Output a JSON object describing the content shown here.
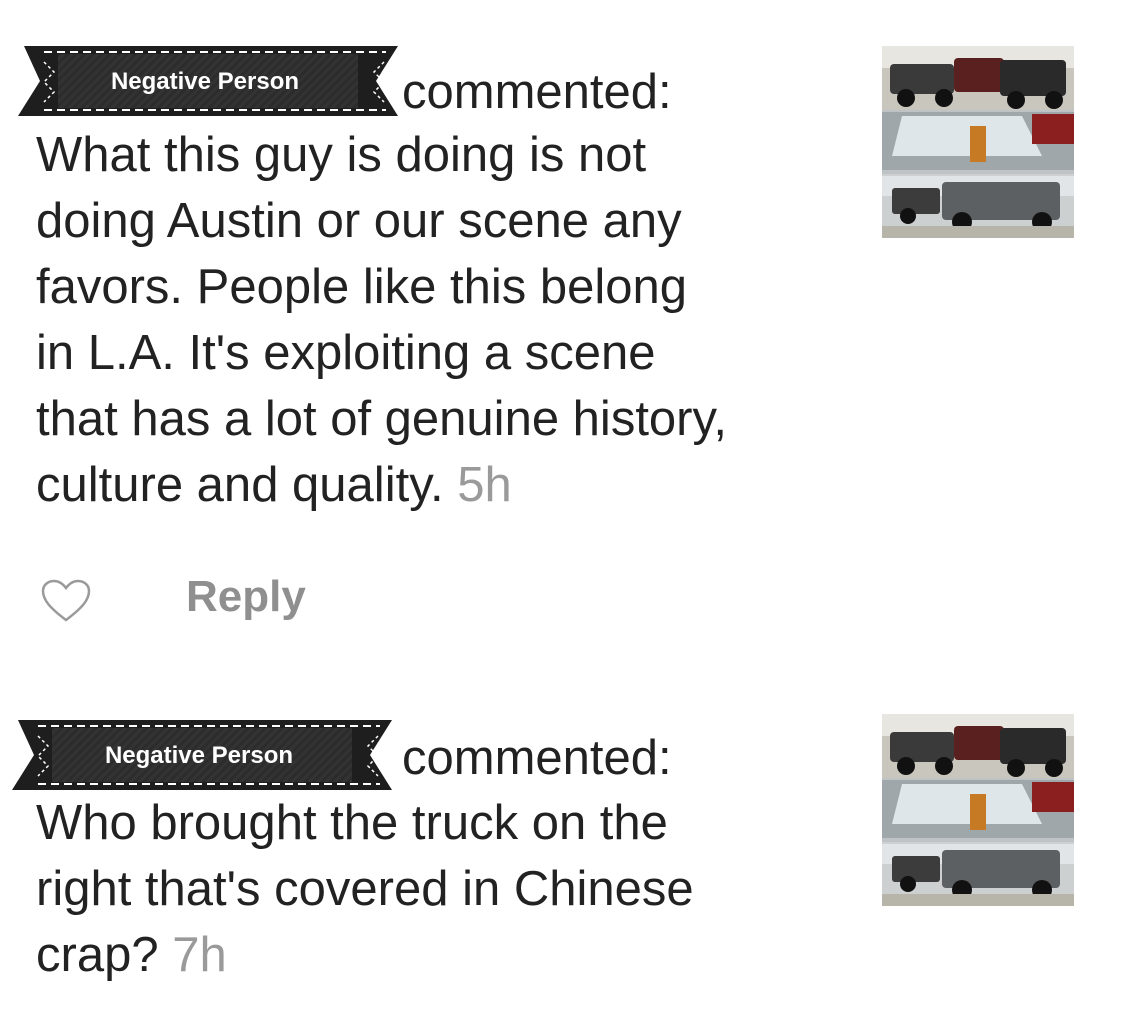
{
  "comments": [
    {
      "author": "Negative Person",
      "verb": "commented:",
      "text": "What this guy is doing is not doing Austin or our scene any favors. People like this belong in L.A. It's exploiting a scene that has a lot of genuine history, culture and quality.",
      "lines": [
        "What this guy is doing is not",
        "doing Austin or our scene any",
        "favors. People like this belong",
        "in L.A. It's exploiting a scene",
        "that has a lot of genuine history,",
        "culture and quality."
      ],
      "time": "5h",
      "like_icon": "heart-outline-icon",
      "reply_label": "Reply"
    },
    {
      "author": "Negative Person",
      "verb": "commented:",
      "text": "Who brought the truck on the right that's covered in Chinese crap?",
      "lines": [
        "Who brought the truck on the",
        "right that's covered in Chinese",
        "crap?"
      ],
      "time": "7h"
    }
  ],
  "colors": {
    "badge_bg": "#2b2b2b",
    "text": "#222222",
    "timestamp": "#9a9a9a",
    "reply": "#8f8f8f"
  }
}
